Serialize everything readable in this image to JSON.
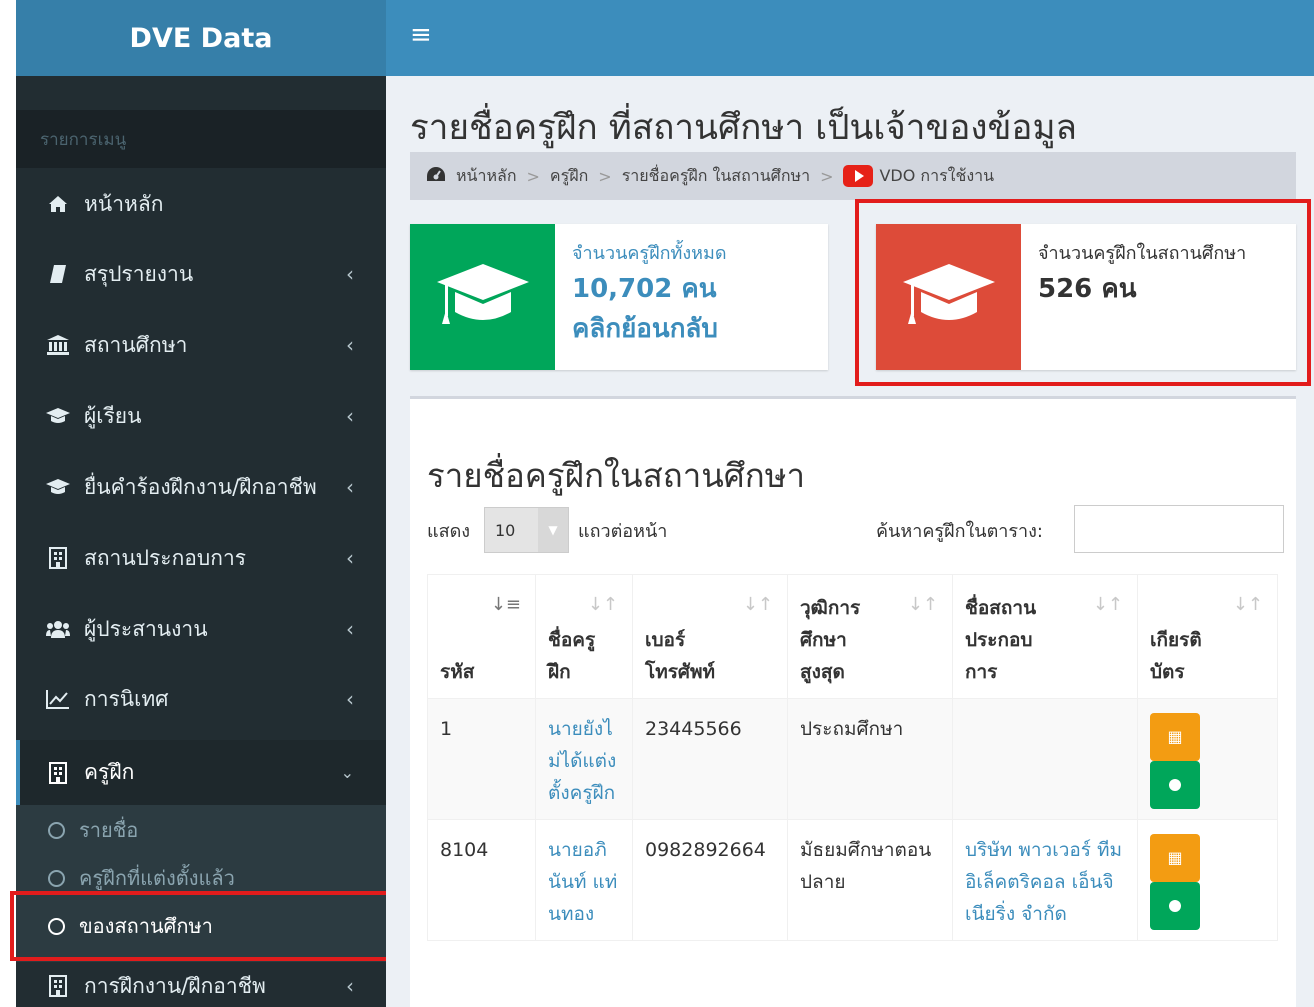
{
  "sidebar": {
    "logo": "DVE Data",
    "header": "รายการเมนู",
    "items": [
      {
        "label": "หน้าหลัก",
        "icon": "home-icon"
      },
      {
        "label": "สรุปรายงาน",
        "icon": "book-icon"
      },
      {
        "label": "สถานศึกษา",
        "icon": "institution-icon"
      },
      {
        "label": "ผู้เรียน",
        "icon": "graduation-cap-icon"
      },
      {
        "label": "ยื่นคำร้องฝึกงาน/ฝึกอาชีพ",
        "icon": "graduation-cap-icon"
      },
      {
        "label": "สถานประกอบการ",
        "icon": "building-icon"
      },
      {
        "label": "ผู้ประสานงาน",
        "icon": "users-icon"
      },
      {
        "label": "การนิเทศ",
        "icon": "line-chart-icon"
      },
      {
        "label": "ครูฝึก",
        "icon": "building-icon"
      },
      {
        "label": "การฝึกงาน/ฝึกอาชีพ",
        "icon": "building-icon"
      }
    ],
    "sub_items": [
      {
        "label": "รายชื่อ"
      },
      {
        "label": "ครูฝึกที่แต่งตั้งแล้ว"
      },
      {
        "label": "ของสถานศึกษา"
      }
    ]
  },
  "topbar": {
    "menu_icon": "hamburger-icon"
  },
  "page": {
    "title": "รายชื่อครูฝึก ที่สถานศึกษา เป็นเจ้าของข้อมูล",
    "breadcrumb": [
      "หน้าหลัก",
      "ครูฝึก",
      "รายชื่อครูฝึก ในสถานศึกษา",
      "VDO การใช้งาน"
    ]
  },
  "info_boxes": [
    {
      "text": "จำนวนครูฝึกทั้งหมด",
      "number": "10,702 คน",
      "link": "คลิกย้อนกลับ",
      "color": "#00a65a"
    },
    {
      "text": "จำนวนครูฝึกในสถานศึกษา",
      "number": "526 คน",
      "color": "#dd4b39"
    }
  ],
  "table_panel": {
    "title": "รายชื่อครูฝึกในสถานศึกษา",
    "length_label": "แสดง",
    "length_value": "10",
    "length_suffix": "แถวต่อหน้า",
    "search_label": "ค้นหาครูฝึกในตาราง:",
    "search_value": "",
    "columns": [
      "รหัส",
      "ชื่อครูฝึก",
      "เบอร์โทรศัพท์",
      "วุฒิการศึกษาสูงสุด",
      "ชื่อสถานประกอบการ",
      "เกียรติบัตร"
    ],
    "rows": [
      {
        "id": "1",
        "name": "นายยังไม่ได้แต่งตั้งครูฝึก",
        "phone": "23445566",
        "education": "ประถมศึกษา",
        "company": ""
      },
      {
        "id": "8104",
        "name": "นายอภินันท์ แท่นทอง",
        "phone": "0982892664",
        "education": "มัธยมศึกษาตอนปลาย",
        "company": "บริษัท พาวเวอร์ ทีม อิเล็คตริคอล เอ็นจิเนียริ่ง จำกัด"
      }
    ]
  },
  "colors": {
    "sidebar_bg": "#222d32",
    "topbar": "#3c8dbc",
    "highlight": "#e21c1c"
  }
}
